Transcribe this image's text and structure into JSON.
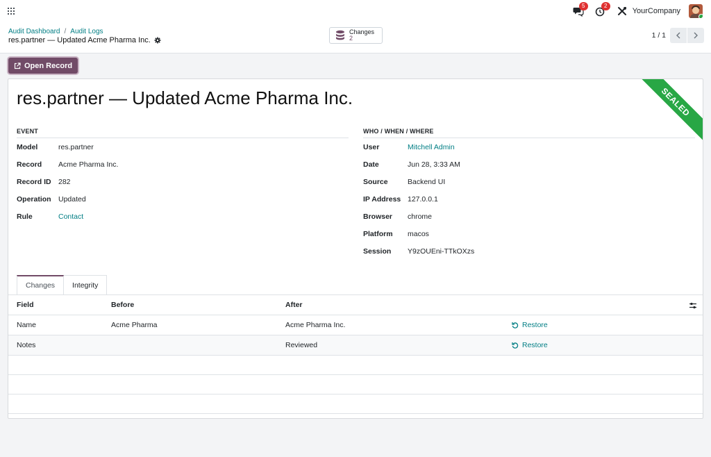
{
  "navbar": {
    "messages_badge": "5",
    "activities_badge": "2",
    "company": "YourCompany"
  },
  "breadcrumb": {
    "items": [
      "Audit Dashboard",
      "Audit Logs"
    ],
    "separator": "/",
    "current": "res.partner — Updated Acme Pharma Inc."
  },
  "stat_button": {
    "label": "Changes",
    "value": "2"
  },
  "pager": {
    "value": "1 / 1"
  },
  "actions": {
    "open_record": "Open Record"
  },
  "record": {
    "title": "res.partner — Updated Acme Pharma Inc.",
    "ribbon": "SEALED",
    "event_group": {
      "title": "EVENT",
      "fields": [
        {
          "label": "Model",
          "value": "res.partner"
        },
        {
          "label": "Record",
          "value": "Acme Pharma Inc."
        },
        {
          "label": "Record ID",
          "value": "282"
        },
        {
          "label": "Operation",
          "value": "Updated"
        },
        {
          "label": "Rule",
          "value": "Contact"
        }
      ]
    },
    "context_group": {
      "title": "WHO / WHEN / WHERE",
      "fields": [
        {
          "label": "User",
          "value": "Mitchell Admin"
        },
        {
          "label": "Date",
          "value": "Jun 28, 3:33 AM"
        },
        {
          "label": "Source",
          "value": "Backend UI"
        },
        {
          "label": "IP Address",
          "value": "127.0.0.1"
        },
        {
          "label": "Browser",
          "value": "chrome"
        },
        {
          "label": "Platform",
          "value": "macos"
        },
        {
          "label": "Session",
          "value": "Y9zOUEni-TTkOXzs"
        }
      ]
    }
  },
  "tabs": [
    "Changes",
    "Integrity"
  ],
  "changes_table": {
    "headers": [
      "Field",
      "Before",
      "After"
    ],
    "rows": [
      {
        "field": "Name",
        "before": "Acme Pharma",
        "after": "Acme Pharma Inc.",
        "action": "Restore"
      },
      {
        "field": "Notes",
        "before": "",
        "after": "Reviewed",
        "action": "Restore"
      }
    ]
  },
  "colors": {
    "brand": "#714b67",
    "link": "#017e84",
    "ribbon": "#28a745",
    "badge": "#e03131"
  }
}
